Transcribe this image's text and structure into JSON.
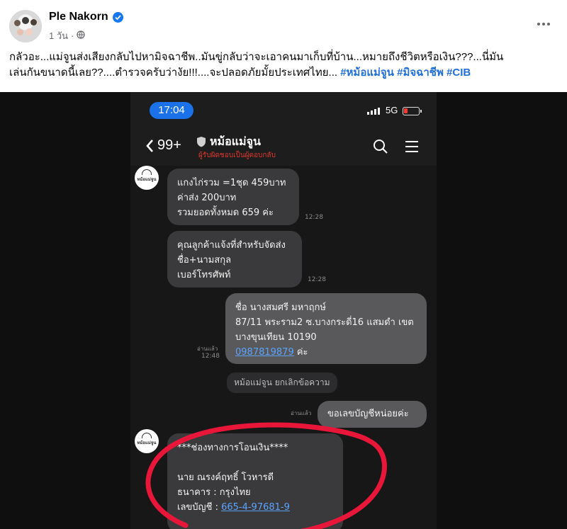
{
  "post": {
    "author": "Ple Nakorn",
    "time": "1 วัน",
    "separator": "·",
    "text_line1": "กลัวอะ...แม่จูนส่งเสียงกลับไปหามิจฉาชีพ..มันขู่กลับว่าจะเอาคนมาเก็บที่บ้าน...หมายถึงชีวิตหรือเงิน???...นี่มัน",
    "text_line2": "เล่นกันขนาดนี้เลย??....ตำรวจครับว่างัย!!!....จะปลอดภัยมั้ยประเทศไทย...",
    "hashtags": [
      "#หม้อแม่จูน",
      "#มิจฉาชีพ",
      "#CIB"
    ]
  },
  "phone": {
    "time": "17:04",
    "network": "5G",
    "battery_color": "#ff3b30"
  },
  "chat": {
    "back_label": "99+",
    "name": "หม้อแม่จูน",
    "subtitle": "ผู้รับผิดชอบเป็นผู้ตอบกลับ",
    "shop_logo_text": "หม้อแม่จูน",
    "messages": [
      {
        "lines": [
          "แกงไก่รวม =1ชุด 459บาท",
          "ค่าส่ง 200บาท",
          "รวมยอดทั้งหมด 659 ค่ะ"
        ],
        "time": "12:28"
      },
      {
        "lines": [
          "คุณลูกค้าแจ้งที่สำหรับจัดส่ง",
          "ชื่อ+นามสกุล",
          "เบอร์โทรศัพท์"
        ],
        "time": "12:28"
      },
      {
        "lines": [
          "ชื่อ นางสมศรี มหาฤกษ์",
          "87/11 พระราม2 ซ.บางกระดี่16 แสมดำ เขต",
          "บางขุนเทียน 10190"
        ],
        "phone_number": "0987819879",
        "suffix": " ค่ะ",
        "read": "อ่านแล้ว",
        "time": "12:48"
      },
      {
        "system": "หม้อแม่จูน ยกเลิกข้อความ"
      },
      {
        "lines": [
          "ขอเลขบัญชีหน่อยค่ะ"
        ],
        "read": "อ่านแล้ว"
      },
      {
        "lines": [
          "***ช่องทางการโอนเงิน****",
          "",
          "นาย ณรงค์ฤทธิ์ โวหารดี",
          "ธนาคาร : กรุงไทย"
        ],
        "account_label": "เลขบัญชี : ",
        "account_number": "665-4-97681-9"
      }
    ]
  },
  "annotation_color": "#e8173a"
}
